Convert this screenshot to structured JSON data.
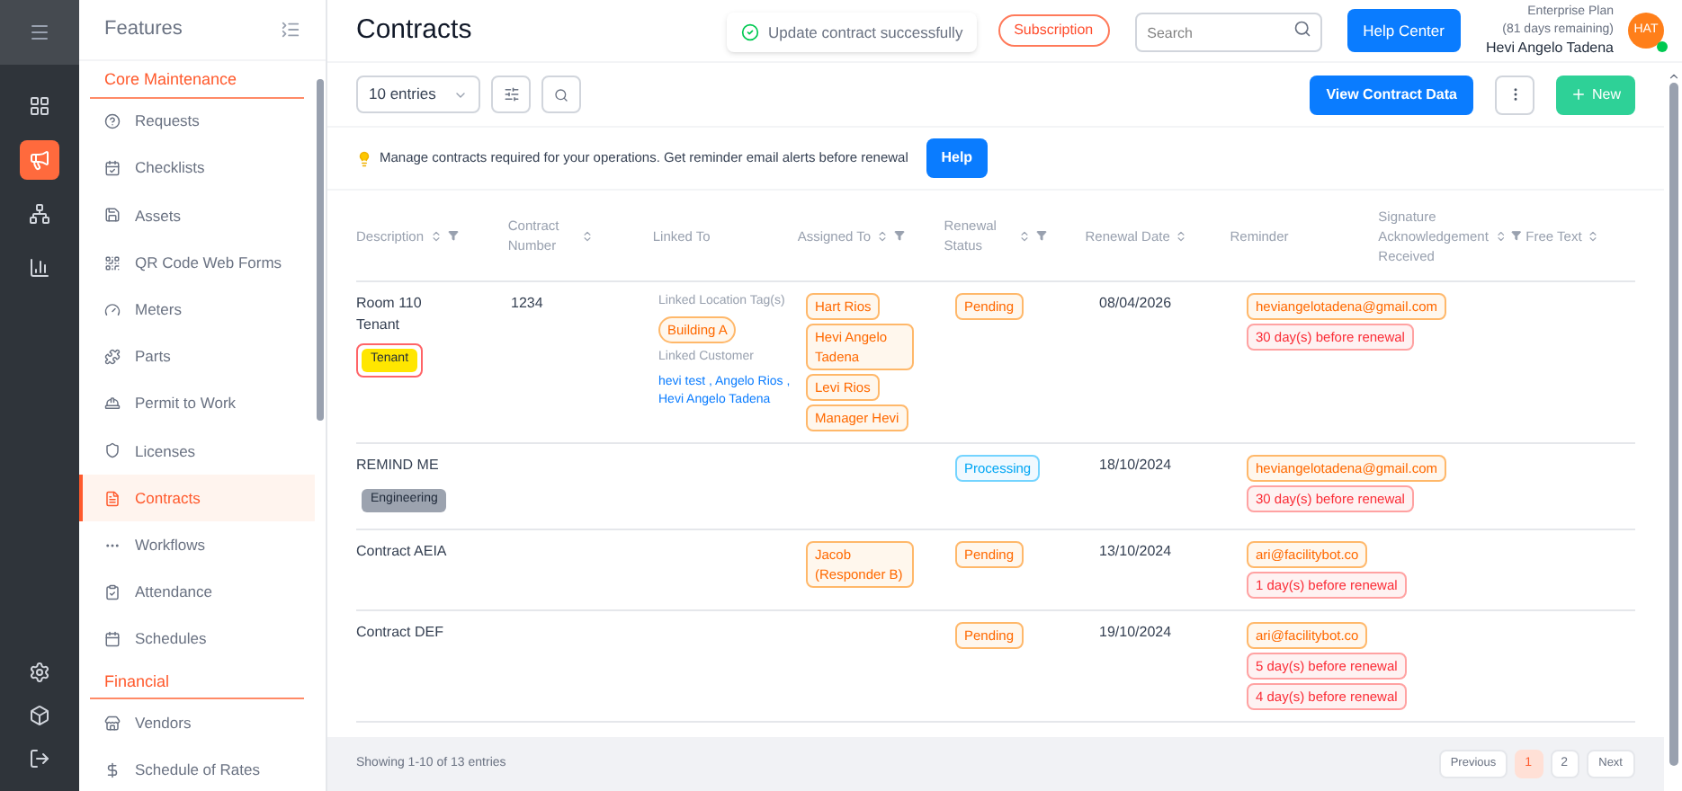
{
  "rail": {
    "items": [
      {
        "kind": "grid",
        "selected": false
      },
      {
        "kind": "megaphone",
        "selected": true
      },
      {
        "kind": "hierarchy",
        "selected": false
      },
      {
        "kind": "chart",
        "selected": false
      }
    ],
    "bottom": [
      {
        "kind": "gear"
      },
      {
        "kind": "cube"
      },
      {
        "kind": "exit"
      }
    ]
  },
  "features": {
    "title": "Features",
    "sections": [
      {
        "title": "Core Maintenance",
        "items": [
          {
            "label": "Requests",
            "selected": false
          },
          {
            "label": "Checklists",
            "selected": false
          },
          {
            "label": "Assets",
            "selected": false
          },
          {
            "label": "QR Code Web Forms",
            "selected": false
          },
          {
            "label": "Meters",
            "selected": false
          },
          {
            "label": "Parts",
            "selected": false
          },
          {
            "label": "Permit to Work",
            "selected": false
          },
          {
            "label": "Licenses",
            "selected": false
          },
          {
            "label": "Contracts",
            "selected": true
          },
          {
            "label": "Workflows",
            "selected": false
          },
          {
            "label": "Attendance",
            "selected": false
          },
          {
            "label": "Schedules",
            "selected": false
          }
        ]
      },
      {
        "title": "Financial",
        "items": [
          {
            "label": "Vendors",
            "selected": false
          },
          {
            "label": "Schedule of Rates",
            "selected": false
          }
        ]
      }
    ]
  },
  "header": {
    "title": "Contracts",
    "toast": "Update contract successfully",
    "subscription": "Subscription",
    "search": {
      "placeholder": "Search"
    },
    "help_center": "Help Center",
    "plan": "Enterprise Plan",
    "days": "(81 days remaining)",
    "user": "Hevi Angelo Tadena",
    "avatar": "HAT"
  },
  "toolbar": {
    "entries": "10 entries",
    "view_data": "View Contract Data",
    "new": "New"
  },
  "notice": {
    "text": "Manage contracts required for your operations. Get reminder email alerts before renewal",
    "help": "Help"
  },
  "table": {
    "columns": [
      "Description",
      "Contract Number",
      "Linked To",
      "Assigned To",
      "Renewal Status",
      "Renewal Date",
      "Reminder",
      "Signature Acknowledgement Received",
      "Free Text"
    ],
    "rows": [
      {
        "description": "Room 110 Tenant",
        "tags": [
          {
            "label": "Tenant",
            "color": "#ffe600",
            "outlined": true
          }
        ],
        "number": "1234",
        "linked": {
          "location_label": "Linked Location Tag(s)",
          "locations": [
            "Building A"
          ],
          "customer_label": "Linked Customer",
          "customers": "hevi test , Angelo Rios , Hevi Angelo Tadena"
        },
        "assigned": [
          "Hart Rios",
          "Hevi Angelo Tadena",
          "Levi Rios",
          "Manager Hevi"
        ],
        "status": {
          "label": "Pending",
          "kind": "pending"
        },
        "date": "08/04/2026",
        "reminders": [
          {
            "label": "heviangelotadena@gmail.com",
            "kind": "email"
          },
          {
            "label": "30 day(s) before renewal",
            "kind": "days"
          }
        ]
      },
      {
        "description": "REMIND ME",
        "tags": [
          {
            "label": "Engineering",
            "color": "#9ca3af",
            "outlined": false
          }
        ],
        "number": "",
        "assigned": [],
        "status": {
          "label": "Processing",
          "kind": "processing"
        },
        "date": "18/10/2024",
        "reminders": [
          {
            "label": "heviangelotadena@gmail.com",
            "kind": "email"
          },
          {
            "label": "30 day(s) before renewal",
            "kind": "days"
          }
        ]
      },
      {
        "description": "Contract AEIA",
        "tags": [],
        "number": "",
        "assigned": [
          "Jacob (Responder B)"
        ],
        "status": {
          "label": "Pending",
          "kind": "pending"
        },
        "date": "13/10/2024",
        "reminders": [
          {
            "label": "ari@facilitybot.co",
            "kind": "email"
          },
          {
            "label": "1 day(s) before renewal",
            "kind": "days"
          }
        ]
      },
      {
        "description": "Contract DEF",
        "tags": [],
        "number": "",
        "assigned": [],
        "status": {
          "label": "Pending",
          "kind": "pending"
        },
        "date": "19/10/2024",
        "reminders": [
          {
            "label": "ari@facilitybot.co",
            "kind": "email"
          },
          {
            "label": "5 day(s) before renewal",
            "kind": "days"
          },
          {
            "label": "4 day(s) before renewal",
            "kind": "days"
          }
        ]
      }
    ]
  },
  "footer": {
    "showing": "Showing 1-10 of 13 entries",
    "previous": "Previous",
    "pages": [
      {
        "label": "1",
        "selected": true
      },
      {
        "label": "2",
        "selected": false
      }
    ],
    "next": "Next"
  }
}
